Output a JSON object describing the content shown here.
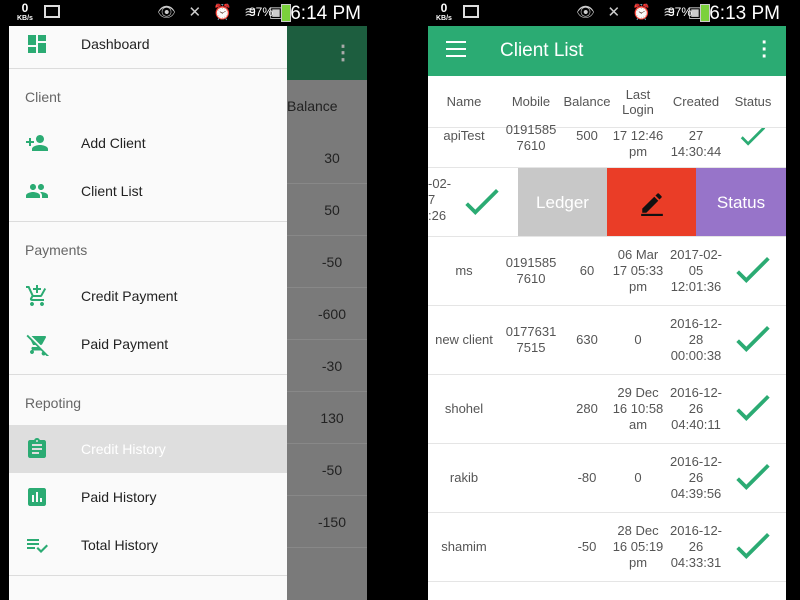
{
  "left_phone": {
    "status": {
      "speed": "0",
      "speed_unit": "KB/s",
      "battery": "97%",
      "time": "6:14 PM"
    },
    "background_list": {
      "header": "Balance",
      "values": [
        "30",
        "50",
        "-50",
        "-600",
        "-30",
        "130",
        "-50",
        "-150"
      ]
    },
    "drawer": {
      "dashboard": "Dashboard",
      "section_client": "Client",
      "add_client": "Add Client",
      "client_list": "Client List",
      "section_payments": "Payments",
      "credit_payment": "Credit Payment",
      "paid_payment": "Paid Payment",
      "section_reporting": "Repoting",
      "credit_history": "Credit History",
      "paid_history": "Paid History",
      "total_history": "Total History"
    }
  },
  "right_phone": {
    "status": {
      "speed": "0",
      "speed_unit": "KB/s",
      "battery": "97%",
      "time": "6:13 PM"
    },
    "app_title": "Client List",
    "columns": {
      "name": "Name",
      "mobile": "Mobile",
      "balance": "Balance",
      "last_login": "Last Login",
      "created": "Created",
      "status": "Status"
    },
    "partial_row": {
      "name": "apiTest",
      "mobile": "0191585 7610",
      "balance": "500",
      "last_login": "17 12:46 pm",
      "created": "27 14:30:44"
    },
    "swiped_row": {
      "fragment": "-02-\n7\n:26",
      "ledger": "Ledger",
      "status": "Status"
    },
    "rows": [
      {
        "name": "ms",
        "mobile": "0191585 7610",
        "balance": "60",
        "last_login": "06 Mar 17 05:33 pm",
        "created": "2017-02-05 12:01:36"
      },
      {
        "name": "new client",
        "mobile": "0177631 7515",
        "balance": "630",
        "last_login": "0",
        "created": "2016-12-28 00:00:38"
      },
      {
        "name": "shohel",
        "mobile": "",
        "balance": "280",
        "last_login": "29 Dec 16 10:58 am",
        "created": "2016-12-26 04:40:11"
      },
      {
        "name": "rakib",
        "mobile": "",
        "balance": "-80",
        "last_login": "0",
        "created": "2016-12-26 04:39:56"
      },
      {
        "name": "shamim",
        "mobile": "",
        "balance": "-50",
        "last_login": "28 Dec 16 05:19 pm",
        "created": "2016-12-26 04:33:31"
      }
    ],
    "colors": {
      "primary": "#2bab73",
      "ledger": "#c8c8c8",
      "edit": "#ea3d27",
      "status": "#9774c9",
      "check": "#2bab73"
    }
  }
}
